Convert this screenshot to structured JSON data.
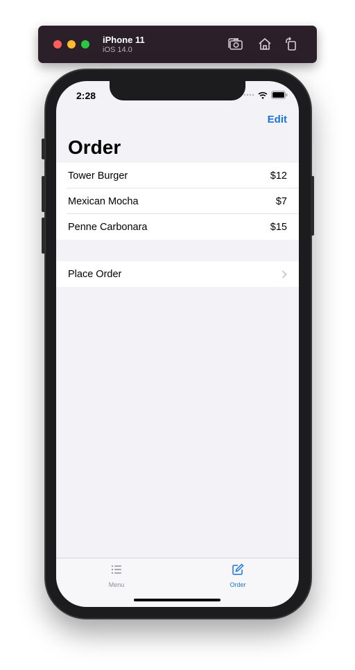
{
  "simulator": {
    "device_name": "iPhone 11",
    "os_version": "iOS 14.0",
    "buttons": [
      "screenshot-icon",
      "home-icon",
      "rotate-icon"
    ]
  },
  "status_bar": {
    "time": "2:28",
    "icons": [
      "signal-icon",
      "wifi-icon",
      "battery-icon"
    ]
  },
  "nav": {
    "edit_label": "Edit",
    "title": "Order"
  },
  "order_items": [
    {
      "name": "Tower Burger",
      "price": "$12"
    },
    {
      "name": "Mexican Mocha",
      "price": "$7"
    },
    {
      "name": "Penne Carbonara",
      "price": "$15"
    }
  ],
  "place_order": {
    "label": "Place Order",
    "icon": "chevron-right-icon"
  },
  "tab_bar": {
    "tabs": [
      {
        "label": "Menu",
        "icon": "list-icon",
        "selected": false
      },
      {
        "label": "Order",
        "icon": "compose-icon",
        "selected": true
      }
    ]
  },
  "colors": {
    "accent": "#1a73d9",
    "background": "#f2f2f7",
    "window_bar": "#2b1f2a"
  }
}
